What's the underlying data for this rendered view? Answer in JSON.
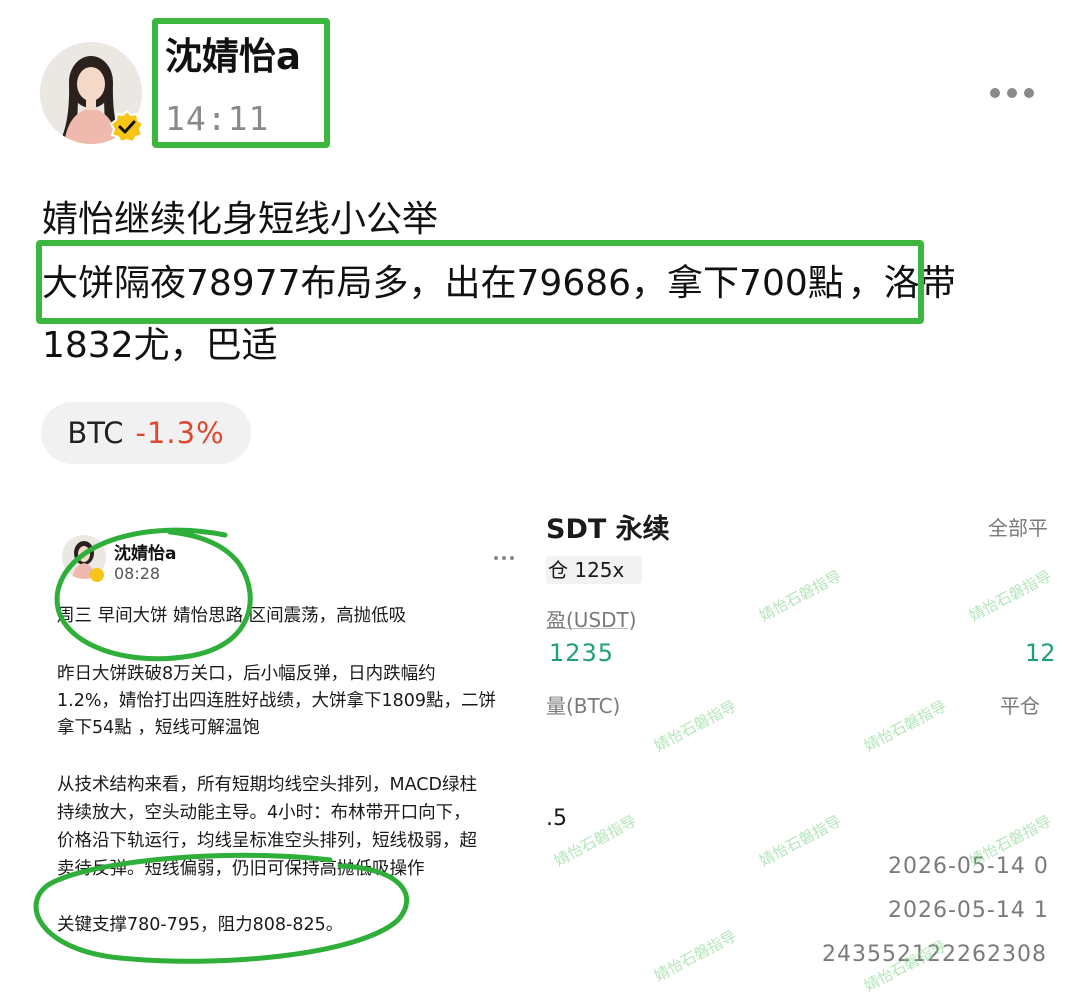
{
  "post": {
    "author": "沈婧怡a",
    "time": "14:11",
    "line1": "婧怡继续化身短线小公举",
    "line2_highlight": "大饼隔夜78977布局多，出在79686，拿下700點",
    "line2_rest": "，洛带",
    "line3": "1832尤，巴适"
  },
  "ticker": {
    "symbol": "BTC",
    "change": "-1.3%"
  },
  "embedded_post": {
    "author": "沈婧怡a",
    "time": "08:28",
    "lines": [
      "周三 早间大饼  婧怡思路 区间震荡，高抛低吸",
      "昨日大饼跌破8万关口，后小幅反弹，日内跌幅约",
      "1.2%，婧怡打出四连胜好战绩，大饼拿下1809點，二饼",
      "拿下54點 ，短线可解温饱",
      "从技术结构来看，所有短期均线空头排列，MACD绿柱",
      "持续放大，空头动能主导。4小时：布林带开口向下，",
      "价格沿下轨运行，均线呈标准空头排列，短线极弱，超",
      "卖待反弹。短线偏弱，仍旧可保持高抛低吸操作",
      "关键支撑780-795，阻力808-825。"
    ]
  },
  "embedded_trade": {
    "title": "SDT 永续",
    "all_label": "全部平",
    "leverage": "仓 125x",
    "margin_label": "盈(USDT)",
    "margin_value": "1235",
    "right_value": "12",
    "qty_label": "量(BTC)",
    "close_label": "平仓",
    "partial_value": ".5",
    "date1": "2026-05-14 0",
    "date2": "2026-05-14 1",
    "order_id": "243552122262308",
    "watermark": "婧怡石磐指导"
  },
  "colors": {
    "highlight_green": "#3db63f",
    "negative_red": "#e0472f",
    "profit_green": "#1fa079"
  },
  "icons": [
    "avatar",
    "verified-badge-icon",
    "more-dots-icon"
  ]
}
